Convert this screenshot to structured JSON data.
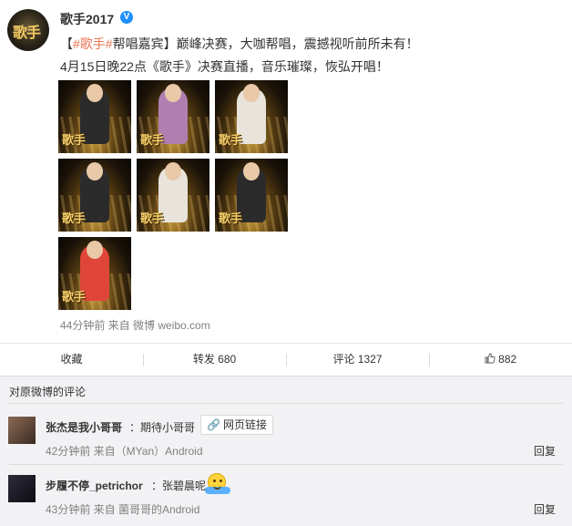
{
  "post": {
    "username": "歌手2017",
    "verified_icon": "verified-v-icon",
    "line1": {
      "bracket_open": "【",
      "hashtag": "#歌手#",
      "rest": "帮唱嘉宾】巅峰决赛，大咖帮唱，震撼视听前所未有！"
    },
    "line2": "4月15日晚22点《歌手》决赛直播，音乐璀璨，恢弘开唱！",
    "image_mark": "歌手",
    "meta": "44分钟前 来自 微博 weibo.com"
  },
  "actions": {
    "favorite": "收藏",
    "forward": "转发 680",
    "comment": "评论 1327",
    "like_icon": "thumbs-up-icon",
    "like": "882"
  },
  "comments": {
    "title": "对原微博的评论",
    "items": [
      {
        "name": "张杰是我小哥哥",
        "text": "：期待小哥哥",
        "link_label": "网页链接",
        "link_icon": "link-icon",
        "time": "42分钟前 来自（MYan）Android",
        "reply": "回复"
      },
      {
        "name": "步履不停_petrichor",
        "text": "：张碧晨呢",
        "emoji_icon": "hugging-emoji-icon",
        "time": "43分钟前 来自 菌哥哥的Android",
        "reply": "回复"
      }
    ]
  },
  "colors": {
    "hashtag": "#eb7350",
    "verified": "#1e90ff",
    "comments_bg": "#f2f2f5"
  }
}
